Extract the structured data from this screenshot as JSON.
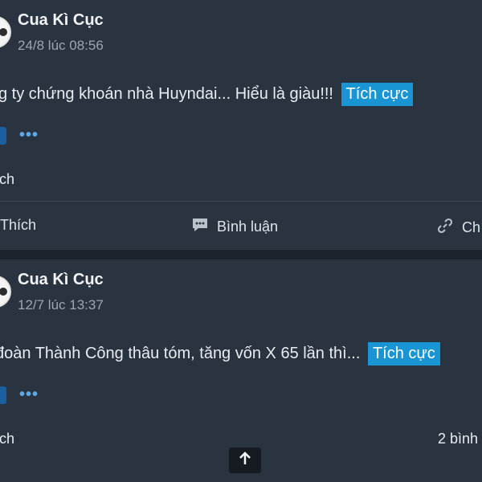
{
  "posts": [
    {
      "author": "Cua Kì Cục",
      "timestamp": "24/8 lúc 08:56",
      "content": "g ty chứng khoán nhà Huyndai... Hiểu là giàu!!!",
      "tag": "Tích cực",
      "like_summary": "ích",
      "comment_count": ""
    },
    {
      "author": "Cua Kì Cục",
      "timestamp": "12/7 lúc 13:37",
      "content": "đoàn Thành Công thâu tóm, tăng vốn X 65 lần thì...",
      "tag": "Tích cực",
      "like_summary": "ích",
      "comment_count": "2 bình"
    }
  ],
  "actions": {
    "like_label": "Thích",
    "comment_label": "Bình luận",
    "share_label": "Ch"
  },
  "more_label": "•••",
  "colors": {
    "page_bg": "#1c232c",
    "card_bg": "#2a3440",
    "tag_bg": "#1a95d3",
    "link_blue": "#5fa8e8"
  },
  "icons": {
    "comment": "comment-icon",
    "share": "link-icon",
    "scroll_top": "arrow-up-icon"
  }
}
